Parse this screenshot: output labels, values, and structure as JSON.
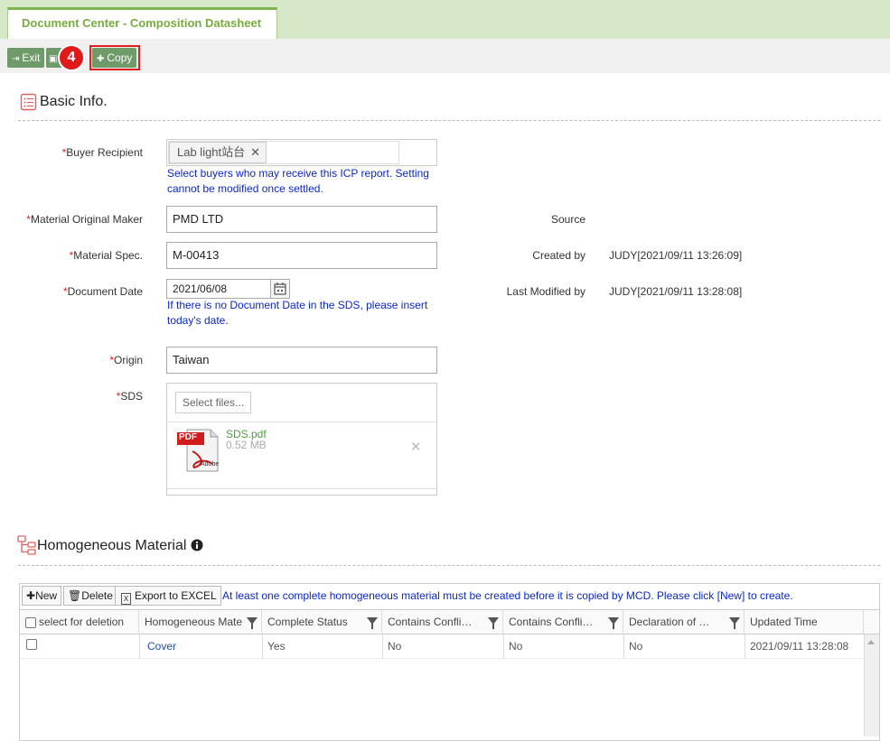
{
  "tab": {
    "title": "Document Center - Composition Datasheet"
  },
  "toolbar": {
    "exit": "Exit",
    "copy": "Copy",
    "step_badge": "4"
  },
  "basic": {
    "title": "Basic Info.",
    "buyer_label": "Buyer Recipient",
    "buyer_chip": "Lab light站台",
    "buyer_hint_1": "Select buyers who may receive this ICP report. Setting",
    "buyer_hint_2": "cannot be modified once settled.",
    "maker_label": "Material Original Maker",
    "maker_value": "PMD LTD",
    "spec_label": "Material Spec.",
    "spec_value": "M-00413",
    "date_label": "Document Date",
    "date_value": "2021/06/08",
    "date_hint_1": "If there is no Document Date in the SDS, please insert",
    "date_hint_2": "today's date.",
    "origin_label": "Origin",
    "origin_value": "Taiwan",
    "sds_label": "SDS",
    "select_files": "Select files...",
    "file_name": "SDS.pdf",
    "file_size": "0.52 MB",
    "pdf_icon_text": "PDF",
    "pdf_brand": "Adobe",
    "source_label": "Source",
    "created_label": "Created by",
    "created_value": "JUDY[2021/09/11 13:26:09]",
    "modified_label": "Last Modified by",
    "modified_value": "JUDY[2021/09/11 13:28:08]"
  },
  "homog": {
    "title": "Homogeneous Material",
    "new": "New",
    "delete": "Delete",
    "export": "Export to EXCEL",
    "notice": "At least one complete homogeneous material must be created before it is copied by MCD. Please click [New] to create.",
    "columns": [
      "select for deletion",
      "Homogeneous Mate",
      "Complete Status",
      "Contains Confli…",
      "Contains Confli…",
      "Declaration of …",
      "Updated Time"
    ],
    "rows": [
      {
        "name": "Cover",
        "complete": "Yes",
        "conf1": "No",
        "conf2": "No",
        "decl": "No",
        "updated": "2021/09/11 13:28:08"
      }
    ]
  },
  "colors": {
    "accent_green": "#76ad3c",
    "button_green": "#6f9a6a",
    "hint_blue": "#0a28c8",
    "required_red": "#e02020"
  }
}
